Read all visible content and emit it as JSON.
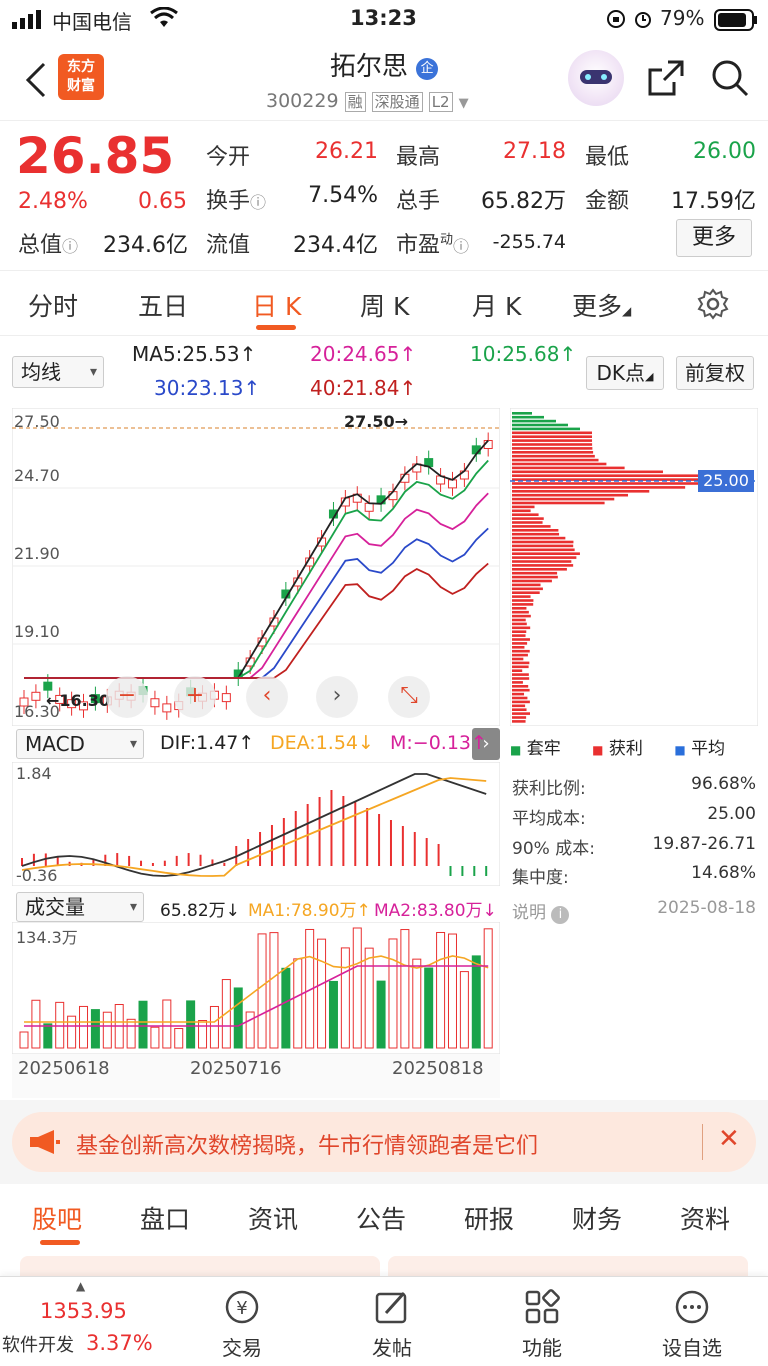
{
  "status_bar": {
    "carrier": "中国电信",
    "time": "13:23",
    "battery": "79%"
  },
  "header": {
    "title": "拓尔思",
    "badge": "企",
    "code": "300229",
    "tags": [
      "融",
      "深股通",
      "L2"
    ],
    "logo_line1": "东方",
    "logo_line2": "财富"
  },
  "quote": {
    "price": "26.85",
    "change_pct": "2.48%",
    "change": "0.65",
    "rows": [
      [
        {
          "label": "今开",
          "value": "26.21",
          "color": "#e93030"
        },
        {
          "label": "最高",
          "value": "27.18",
          "color": "#e93030"
        },
        {
          "label": "最低",
          "value": "26.00",
          "color": "#1aa34a"
        }
      ],
      [
        {
          "label": "换手",
          "value": "7.54%",
          "color": "#333333"
        },
        {
          "label": "总手",
          "value": "65.82万",
          "color": "#333333"
        },
        {
          "label": "金额",
          "value": "17.59亿",
          "color": "#333333"
        }
      ],
      [
        {
          "label": "总值",
          "value": "234.6亿",
          "color": "#333333"
        },
        {
          "label": "流值",
          "value": "234.4亿",
          "color": "#333333"
        },
        {
          "label": "市盈",
          "sup": "动",
          "value": "-255.74",
          "color": "#333333"
        }
      ]
    ],
    "more_label": "更多"
  },
  "period_tabs": [
    "分时",
    "五日",
    "日 K",
    "周 K",
    "月 K",
    "更多"
  ],
  "active_period": 2,
  "ma": {
    "select": "均线",
    "ma5": "MA5:25.53↑",
    "ma10": "10:25.68↑",
    "ma20": "20:24.65↑",
    "ma30": "30:23.13↑",
    "ma40": "40:21.84↑",
    "dk_label": "DK点",
    "fq_label": "前复权"
  },
  "kline": {
    "y_labels": [
      "27.50",
      "24.70",
      "21.90",
      "19.10",
      "16.30"
    ],
    "high_marker": "27.50→",
    "low_marker": "←16.30",
    "ref_price": "25.00",
    "buttons": [
      "−",
      "+",
      "‹",
      "›",
      "⤡"
    ]
  },
  "chip": {
    "legend": [
      {
        "label": "套牢",
        "color": "#1aa34a"
      },
      {
        "label": "获利",
        "color": "#e93030"
      },
      {
        "label": "平均",
        "color": "#2a6fdb"
      }
    ],
    "stats": [
      {
        "label": "获利比例:",
        "value": "96.68%"
      },
      {
        "label": "平均成本:",
        "value": "25.00"
      },
      {
        "label": "90% 成本:",
        "value": "19.87-26.71"
      },
      {
        "label": "集中度:",
        "value": "14.68%"
      }
    ],
    "note_label": "说明",
    "date": "2025-08-18"
  },
  "macd": {
    "select": "MACD",
    "dif": "DIF:1.47↑",
    "dea": "DEA:1.54↓",
    "m": "M:−0.13↑",
    "y_top": "1.84",
    "y_bottom": "-0.36"
  },
  "volume": {
    "select": "成交量",
    "vol": "65.82万↓",
    "ma1": "MA1:78.90万↑",
    "ma2": "MA2:83.80万↓",
    "y_top": "134.3万",
    "dates": [
      "20250618",
      "20250716",
      "20250818"
    ]
  },
  "banner": {
    "text": "基金创新高次数榜揭晓，牛市行情领跑者是它们"
  },
  "bottom_tabs": [
    "股吧",
    "盘口",
    "资讯",
    "公告",
    "研报",
    "财务",
    "资料"
  ],
  "nav": {
    "index_value": "1353.95",
    "sector": "软件开发",
    "sector_pct": "3.37%",
    "items": [
      "交易",
      "发帖",
      "功能",
      "设自选"
    ]
  }
}
